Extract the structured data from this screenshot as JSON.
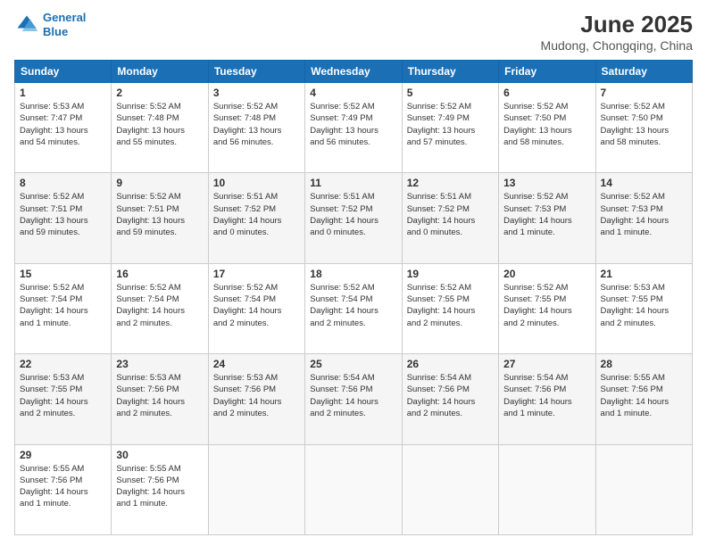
{
  "header": {
    "logo_line1": "General",
    "logo_line2": "Blue",
    "title": "June 2025",
    "subtitle": "Mudong, Chongqing, China"
  },
  "days_of_week": [
    "Sunday",
    "Monday",
    "Tuesday",
    "Wednesday",
    "Thursday",
    "Friday",
    "Saturday"
  ],
  "weeks": [
    [
      {
        "day": "1",
        "info": "Sunrise: 5:53 AM\nSunset: 7:47 PM\nDaylight: 13 hours\nand 54 minutes."
      },
      {
        "day": "2",
        "info": "Sunrise: 5:52 AM\nSunset: 7:48 PM\nDaylight: 13 hours\nand 55 minutes."
      },
      {
        "day": "3",
        "info": "Sunrise: 5:52 AM\nSunset: 7:48 PM\nDaylight: 13 hours\nand 56 minutes."
      },
      {
        "day": "4",
        "info": "Sunrise: 5:52 AM\nSunset: 7:49 PM\nDaylight: 13 hours\nand 56 minutes."
      },
      {
        "day": "5",
        "info": "Sunrise: 5:52 AM\nSunset: 7:49 PM\nDaylight: 13 hours\nand 57 minutes."
      },
      {
        "day": "6",
        "info": "Sunrise: 5:52 AM\nSunset: 7:50 PM\nDaylight: 13 hours\nand 58 minutes."
      },
      {
        "day": "7",
        "info": "Sunrise: 5:52 AM\nSunset: 7:50 PM\nDaylight: 13 hours\nand 58 minutes."
      }
    ],
    [
      {
        "day": "8",
        "info": "Sunrise: 5:52 AM\nSunset: 7:51 PM\nDaylight: 13 hours\nand 59 minutes."
      },
      {
        "day": "9",
        "info": "Sunrise: 5:52 AM\nSunset: 7:51 PM\nDaylight: 13 hours\nand 59 minutes."
      },
      {
        "day": "10",
        "info": "Sunrise: 5:51 AM\nSunset: 7:52 PM\nDaylight: 14 hours\nand 0 minutes."
      },
      {
        "day": "11",
        "info": "Sunrise: 5:51 AM\nSunset: 7:52 PM\nDaylight: 14 hours\nand 0 minutes."
      },
      {
        "day": "12",
        "info": "Sunrise: 5:51 AM\nSunset: 7:52 PM\nDaylight: 14 hours\nand 0 minutes."
      },
      {
        "day": "13",
        "info": "Sunrise: 5:52 AM\nSunset: 7:53 PM\nDaylight: 14 hours\nand 1 minute."
      },
      {
        "day": "14",
        "info": "Sunrise: 5:52 AM\nSunset: 7:53 PM\nDaylight: 14 hours\nand 1 minute."
      }
    ],
    [
      {
        "day": "15",
        "info": "Sunrise: 5:52 AM\nSunset: 7:54 PM\nDaylight: 14 hours\nand 1 minute."
      },
      {
        "day": "16",
        "info": "Sunrise: 5:52 AM\nSunset: 7:54 PM\nDaylight: 14 hours\nand 2 minutes."
      },
      {
        "day": "17",
        "info": "Sunrise: 5:52 AM\nSunset: 7:54 PM\nDaylight: 14 hours\nand 2 minutes."
      },
      {
        "day": "18",
        "info": "Sunrise: 5:52 AM\nSunset: 7:54 PM\nDaylight: 14 hours\nand 2 minutes."
      },
      {
        "day": "19",
        "info": "Sunrise: 5:52 AM\nSunset: 7:55 PM\nDaylight: 14 hours\nand 2 minutes."
      },
      {
        "day": "20",
        "info": "Sunrise: 5:52 AM\nSunset: 7:55 PM\nDaylight: 14 hours\nand 2 minutes."
      },
      {
        "day": "21",
        "info": "Sunrise: 5:53 AM\nSunset: 7:55 PM\nDaylight: 14 hours\nand 2 minutes."
      }
    ],
    [
      {
        "day": "22",
        "info": "Sunrise: 5:53 AM\nSunset: 7:55 PM\nDaylight: 14 hours\nand 2 minutes."
      },
      {
        "day": "23",
        "info": "Sunrise: 5:53 AM\nSunset: 7:56 PM\nDaylight: 14 hours\nand 2 minutes."
      },
      {
        "day": "24",
        "info": "Sunrise: 5:53 AM\nSunset: 7:56 PM\nDaylight: 14 hours\nand 2 minutes."
      },
      {
        "day": "25",
        "info": "Sunrise: 5:54 AM\nSunset: 7:56 PM\nDaylight: 14 hours\nand 2 minutes."
      },
      {
        "day": "26",
        "info": "Sunrise: 5:54 AM\nSunset: 7:56 PM\nDaylight: 14 hours\nand 2 minutes."
      },
      {
        "day": "27",
        "info": "Sunrise: 5:54 AM\nSunset: 7:56 PM\nDaylight: 14 hours\nand 1 minute."
      },
      {
        "day": "28",
        "info": "Sunrise: 5:55 AM\nSunset: 7:56 PM\nDaylight: 14 hours\nand 1 minute."
      }
    ],
    [
      {
        "day": "29",
        "info": "Sunrise: 5:55 AM\nSunset: 7:56 PM\nDaylight: 14 hours\nand 1 minute."
      },
      {
        "day": "30",
        "info": "Sunrise: 5:55 AM\nSunset: 7:56 PM\nDaylight: 14 hours\nand 1 minute."
      },
      {
        "day": "",
        "info": ""
      },
      {
        "day": "",
        "info": ""
      },
      {
        "day": "",
        "info": ""
      },
      {
        "day": "",
        "info": ""
      },
      {
        "day": "",
        "info": ""
      }
    ]
  ]
}
